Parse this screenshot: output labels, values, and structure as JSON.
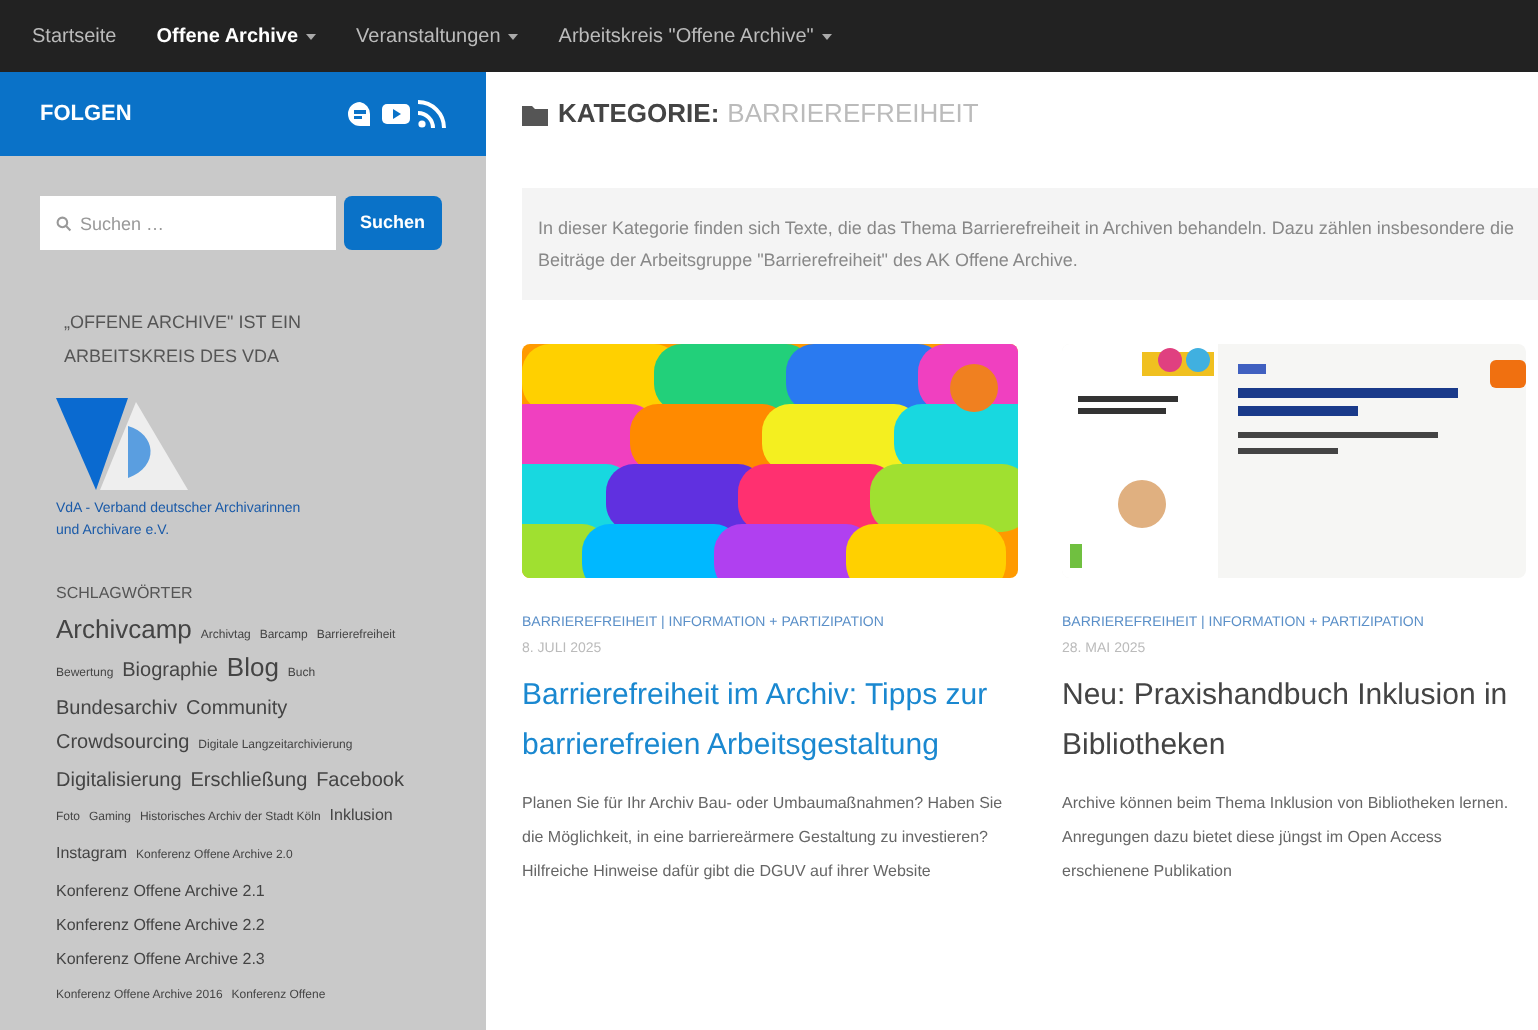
{
  "nav": [
    {
      "label": "Startseite",
      "selected": false,
      "dropdown": false
    },
    {
      "label": "Offene Archive",
      "selected": true,
      "dropdown": true
    },
    {
      "label": "Veranstaltungen",
      "selected": false,
      "dropdown": true
    },
    {
      "label": "Arbeitskreis \"Offene Archive\"",
      "selected": false,
      "dropdown": true
    }
  ],
  "sidebar": {
    "follow": {
      "title": "FOLGEN",
      "icons": [
        {
          "kind": "chat"
        },
        {
          "kind": "video"
        },
        {
          "kind": "rss"
        }
      ]
    },
    "search": {
      "placeholder": "Suchen …",
      "button": "Suchen"
    },
    "about": {
      "title": "„OFFENE ARCHIVE\" IST EIN ARBEITSKREIS DES VDA",
      "link": "VdA - Verband deutscher Archivarinnen und Archivare e.V."
    },
    "tags_title": "SCHLAGWÖRTER",
    "tags": [
      {
        "label": "Archivcamp",
        "kind": "large"
      },
      {
        "label": "Archivtag",
        "kind": "tiny"
      },
      {
        "label": "Barcamp",
        "kind": "tiny"
      },
      {
        "label": "Barrierefreiheit",
        "kind": "tiny"
      },
      {
        "label": "Bewertung",
        "kind": "tiny"
      },
      {
        "label": "Biographie",
        "kind": "medium"
      },
      {
        "label": "Blog",
        "kind": "large"
      },
      {
        "label": "Buch",
        "kind": "tiny"
      },
      {
        "label": "Bundesarchiv",
        "kind": "medium"
      },
      {
        "label": "Community",
        "kind": "medium"
      },
      {
        "label": "Crowdsourcing",
        "kind": "medium"
      },
      {
        "label": "Digitale Langzeitarchivierung",
        "kind": "tiny"
      },
      {
        "label": "Digitalisierung",
        "kind": "medium"
      },
      {
        "label": "Erschließung",
        "kind": "medium"
      },
      {
        "label": "Facebook",
        "kind": "medium"
      },
      {
        "label": "Foto",
        "kind": "tiny"
      },
      {
        "label": "Gaming",
        "kind": "tiny"
      },
      {
        "label": "Historisches Archiv der Stadt Köln",
        "kind": "tiny"
      },
      {
        "label": "Inklusion",
        "kind": "small"
      },
      {
        "label": "Instagram",
        "kind": "small"
      },
      {
        "label": "Konferenz Offene Archive 2.0",
        "kind": "tiny"
      },
      {
        "label": "Konferenz Offene Archive 2.1",
        "kind": "small"
      },
      {
        "label": "Konferenz Offene Archive 2.2",
        "kind": "small"
      },
      {
        "label": "Konferenz Offene Archive 2.3",
        "kind": "small"
      },
      {
        "label": "Konferenz Offene Archive 2016",
        "kind": "tiny"
      },
      {
        "label": "Konferenz Offene",
        "kind": "tiny"
      }
    ]
  },
  "main": {
    "heading_label": "KATEGORIE:",
    "heading_value": "BARRIEREFREIHEIT",
    "description": "In dieser Kategorie finden sich Texte, die das Thema Barrierefreiheit in Archiven behandeln. Dazu zählen insbesondere die Beiträge der Arbeitsgruppe \"Barrierefreiheit\" des AK Offene Archive.",
    "posts": [
      {
        "categories": "BARRIEREFREIHEIT | INFORMATION + PARTIZIPATION",
        "date": "8. JULI 2025",
        "title": "Barrierefreiheit im Archiv: Tipps zur barrierefreien Arbeitsgestaltung",
        "link_color": true,
        "excerpt": "Planen Sie für Ihr Archiv Bau- oder Umbaumaßnahmen? Haben Sie die Möglichkeit, in eine barriereärmere Gestaltung zu investieren? Hilfreiche Hinweise dafür gibt die DGUV auf ihrer Website"
      },
      {
        "categories": "BARRIEREFREIHEIT | INFORMATION + PARTIZIPATION",
        "date": "28. MAI 2025",
        "title": "Neu: Praxishandbuch Inklusion in Bibliotheken",
        "link_color": false,
        "excerpt": "Archive können beim Thema Inklusion von Bibliotheken lernen. Anregungen dazu bietet diese jüngst im Open Access erschienene Publikation"
      }
    ]
  }
}
